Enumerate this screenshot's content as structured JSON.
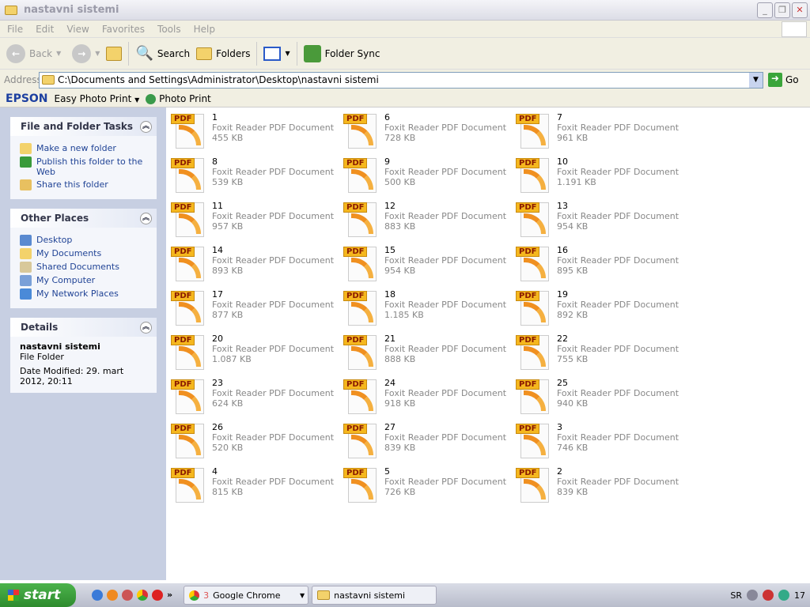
{
  "window": {
    "title": "nastavni sistemi"
  },
  "menu": [
    "File",
    "Edit",
    "View",
    "Favorites",
    "Tools",
    "Help"
  ],
  "toolbar": {
    "back": "Back",
    "search": "Search",
    "folders": "Folders",
    "folder_sync": "Folder Sync"
  },
  "address": {
    "label": "Address",
    "value": "C:\\Documents and Settings\\Administrator\\Desktop\\nastavni sistemi",
    "go": "Go"
  },
  "epson": {
    "brand": "EPSON",
    "easy": "Easy Photo Print",
    "photo": "Photo Print"
  },
  "tasks": {
    "title": "File and Folder Tasks",
    "items": [
      "Make a new folder",
      "Publish this folder to the Web",
      "Share this folder"
    ]
  },
  "places": {
    "title": "Other Places",
    "items": [
      "Desktop",
      "My Documents",
      "Shared Documents",
      "My Computer",
      "My Network Places"
    ]
  },
  "details": {
    "title": "Details",
    "name": "nastavni sistemi",
    "type": "File Folder",
    "modified": "Date Modified: 29. mart 2012, 20:11"
  },
  "file_type": "Foxit Reader PDF Document",
  "files": [
    {
      "name": "1",
      "size": "455 KB"
    },
    {
      "name": "6",
      "size": "728 KB"
    },
    {
      "name": "7",
      "size": "961 KB"
    },
    {
      "name": "8",
      "size": "539 KB"
    },
    {
      "name": "9",
      "size": "500 KB"
    },
    {
      "name": "10",
      "size": "1.191 KB"
    },
    {
      "name": "11",
      "size": "957 KB"
    },
    {
      "name": "12",
      "size": "883 KB"
    },
    {
      "name": "13",
      "size": "954 KB"
    },
    {
      "name": "14",
      "size": "893 KB"
    },
    {
      "name": "15",
      "size": "954 KB"
    },
    {
      "name": "16",
      "size": "895 KB"
    },
    {
      "name": "17",
      "size": "877 KB"
    },
    {
      "name": "18",
      "size": "1.185 KB"
    },
    {
      "name": "19",
      "size": "892 KB"
    },
    {
      "name": "20",
      "size": "1.087 KB"
    },
    {
      "name": "21",
      "size": "888 KB"
    },
    {
      "name": "22",
      "size": "755 KB"
    },
    {
      "name": "23",
      "size": "624 KB"
    },
    {
      "name": "24",
      "size": "918 KB"
    },
    {
      "name": "25",
      "size": "940 KB"
    },
    {
      "name": "26",
      "size": "520 KB"
    },
    {
      "name": "27",
      "size": "839 KB"
    },
    {
      "name": "3",
      "size": "746 KB"
    },
    {
      "name": "4",
      "size": "815 KB"
    },
    {
      "name": "5",
      "size": "726 KB"
    },
    {
      "name": "2",
      "size": "839 KB"
    }
  ],
  "pdf_tag": "PDF",
  "taskbar": {
    "start": "start",
    "chrome_count": "3",
    "chrome": "Google Chrome",
    "explorer": "nastavni sistemi",
    "lang": "SR",
    "clock": "17",
    "more": "»"
  }
}
